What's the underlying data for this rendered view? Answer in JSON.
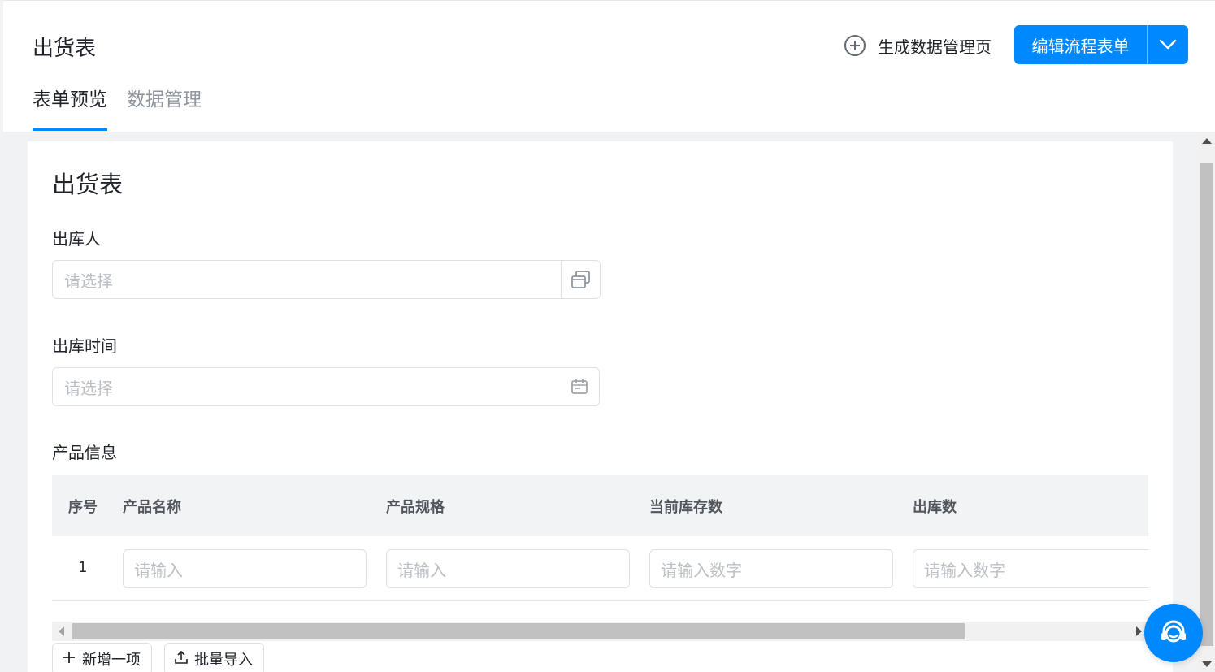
{
  "header": {
    "title": "出货表",
    "generate_label": "生成数据管理页",
    "edit_label": "编辑流程表单",
    "accent": "#0089ff"
  },
  "tabs": [
    {
      "label": "表单预览",
      "active": true
    },
    {
      "label": "数据管理",
      "active": false
    }
  ],
  "form": {
    "title": "出货表",
    "fields": [
      {
        "label": "出库人",
        "placeholder": "请选择",
        "icon": "member-select-icon"
      },
      {
        "label": "出库时间",
        "placeholder": "请选择",
        "icon": "calendar-icon"
      }
    ],
    "table": {
      "label": "产品信息",
      "columns": [
        "序号",
        "产品名称",
        "产品规格",
        "当前库存数",
        "出库数"
      ],
      "rows": [
        {
          "index": "1",
          "inputs": [
            "请输入",
            "请输入",
            "请输入数字",
            "请输入数字"
          ]
        }
      ]
    },
    "actions": {
      "add_label": "新增一项",
      "import_label": "批量导入"
    }
  },
  "support": {
    "icon": "customer-service-icon"
  }
}
